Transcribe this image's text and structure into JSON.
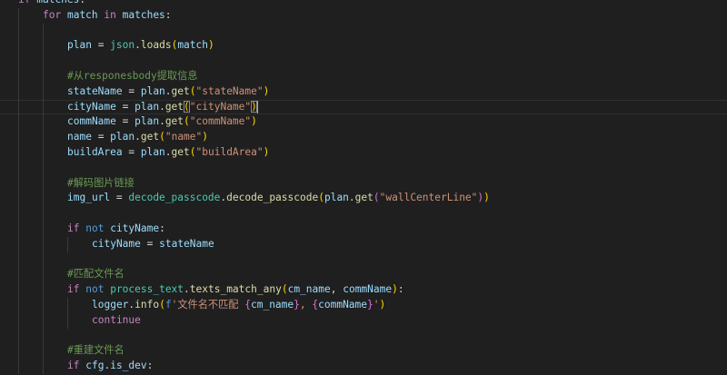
{
  "editor": {
    "current_line": 7,
    "lines": [
      {
        "indent": 0,
        "tokens": [
          [
            "if",
            "kw"
          ],
          [
            " ",
            "op"
          ],
          [
            "matches",
            "var"
          ],
          [
            ":",
            "op"
          ]
        ]
      },
      {
        "indent": 1,
        "tokens": [
          [
            "for",
            "kw"
          ],
          [
            " ",
            "op"
          ],
          [
            "match",
            "var"
          ],
          [
            " ",
            "op"
          ],
          [
            "in",
            "kw"
          ],
          [
            " ",
            "op"
          ],
          [
            "matches",
            "var"
          ],
          [
            ":",
            "op"
          ]
        ]
      },
      {
        "indent": 2,
        "tokens": []
      },
      {
        "indent": 2,
        "tokens": [
          [
            "plan",
            "var"
          ],
          [
            " = ",
            "op"
          ],
          [
            "json",
            "mod"
          ],
          [
            ".",
            "op"
          ],
          [
            "loads",
            "fn"
          ],
          [
            "(",
            "b1"
          ],
          [
            "match",
            "var"
          ],
          [
            ")",
            "b1"
          ]
        ]
      },
      {
        "indent": 2,
        "tokens": []
      },
      {
        "indent": 2,
        "tokens": [
          [
            "#从responesbody提取信息",
            "cm"
          ]
        ]
      },
      {
        "indent": 2,
        "tokens": [
          [
            "stateName",
            "var"
          ],
          [
            " = ",
            "op"
          ],
          [
            "plan",
            "var"
          ],
          [
            ".",
            "op"
          ],
          [
            "get",
            "fn"
          ],
          [
            "(",
            "b1"
          ],
          [
            "\"stateName\"",
            "str"
          ],
          [
            ")",
            "b1"
          ]
        ]
      },
      {
        "indent": 2,
        "tokens": [
          [
            "cityName",
            "var"
          ],
          [
            " = ",
            "op"
          ],
          [
            "plan",
            "var"
          ],
          [
            ".",
            "op"
          ],
          [
            "get",
            "fn"
          ],
          [
            "(",
            "b1 match"
          ],
          [
            "\"cityName\"",
            "str"
          ],
          [
            ")",
            "b1 match"
          ]
        ]
      },
      {
        "indent": 2,
        "tokens": [
          [
            "commName",
            "var"
          ],
          [
            " = ",
            "op"
          ],
          [
            "plan",
            "var"
          ],
          [
            ".",
            "op"
          ],
          [
            "get",
            "fn"
          ],
          [
            "(",
            "b1"
          ],
          [
            "\"commName\"",
            "str"
          ],
          [
            ")",
            "b1"
          ]
        ]
      },
      {
        "indent": 2,
        "tokens": [
          [
            "name",
            "var"
          ],
          [
            " = ",
            "op"
          ],
          [
            "plan",
            "var"
          ],
          [
            ".",
            "op"
          ],
          [
            "get",
            "fn"
          ],
          [
            "(",
            "b1"
          ],
          [
            "\"name\"",
            "str"
          ],
          [
            ")",
            "b1"
          ]
        ]
      },
      {
        "indent": 2,
        "tokens": [
          [
            "buildArea",
            "var"
          ],
          [
            " = ",
            "op"
          ],
          [
            "plan",
            "var"
          ],
          [
            ".",
            "op"
          ],
          [
            "get",
            "fn"
          ],
          [
            "(",
            "b1"
          ],
          [
            "\"buildArea\"",
            "str"
          ],
          [
            ")",
            "b1"
          ]
        ]
      },
      {
        "indent": 2,
        "tokens": []
      },
      {
        "indent": 2,
        "tokens": [
          [
            "#解码图片链接",
            "cm"
          ]
        ]
      },
      {
        "indent": 2,
        "tokens": [
          [
            "img_url",
            "var"
          ],
          [
            " = ",
            "op"
          ],
          [
            "decode_passcode",
            "mod"
          ],
          [
            ".",
            "op"
          ],
          [
            "decode_passcode",
            "fn"
          ],
          [
            "(",
            "b1"
          ],
          [
            "plan",
            "var"
          ],
          [
            ".",
            "op"
          ],
          [
            "get",
            "fn"
          ],
          [
            "(",
            "b2"
          ],
          [
            "\"wallCenterLine\"",
            "str"
          ],
          [
            ")",
            "b2"
          ],
          [
            ")",
            "b1"
          ]
        ]
      },
      {
        "indent": 2,
        "tokens": []
      },
      {
        "indent": 2,
        "tokens": [
          [
            "if",
            "kw"
          ],
          [
            " ",
            "op"
          ],
          [
            "not",
            "kb"
          ],
          [
            " ",
            "op"
          ],
          [
            "cityName",
            "var"
          ],
          [
            ":",
            "op"
          ]
        ]
      },
      {
        "indent": 3,
        "tokens": [
          [
            "cityName",
            "var"
          ],
          [
            " = ",
            "op"
          ],
          [
            "stateName",
            "var"
          ]
        ]
      },
      {
        "indent": 2,
        "tokens": []
      },
      {
        "indent": 2,
        "tokens": [
          [
            "#匹配文件名",
            "cm"
          ]
        ]
      },
      {
        "indent": 2,
        "tokens": [
          [
            "if",
            "kw"
          ],
          [
            " ",
            "op"
          ],
          [
            "not",
            "kb"
          ],
          [
            " ",
            "op"
          ],
          [
            "process_text",
            "mod"
          ],
          [
            ".",
            "op"
          ],
          [
            "texts_match_any",
            "fn"
          ],
          [
            "(",
            "b1"
          ],
          [
            "cm_name",
            "var"
          ],
          [
            ", ",
            "op"
          ],
          [
            "commName",
            "var"
          ],
          [
            ")",
            "b1"
          ],
          [
            ":",
            "op"
          ]
        ]
      },
      {
        "indent": 3,
        "tokens": [
          [
            "logger",
            "var"
          ],
          [
            ".",
            "op"
          ],
          [
            "info",
            "fn"
          ],
          [
            "(",
            "b1"
          ],
          [
            "f",
            "kb"
          ],
          [
            "'文件名不匹配 ",
            "str"
          ],
          [
            "{",
            "b2"
          ],
          [
            "cm_name",
            "var"
          ],
          [
            "}",
            "b2"
          ],
          [
            ", ",
            "str"
          ],
          [
            "{",
            "b2"
          ],
          [
            "commName",
            "var"
          ],
          [
            "}",
            "b2"
          ],
          [
            "'",
            "str"
          ],
          [
            ")",
            "b1"
          ]
        ]
      },
      {
        "indent": 3,
        "tokens": [
          [
            "continue",
            "kw"
          ]
        ]
      },
      {
        "indent": 2,
        "tokens": []
      },
      {
        "indent": 2,
        "tokens": [
          [
            "#重建文件名",
            "cm"
          ]
        ]
      },
      {
        "indent": 2,
        "tokens": [
          [
            "if",
            "kw"
          ],
          [
            " ",
            "op"
          ],
          [
            "cfg",
            "var"
          ],
          [
            ".",
            "op"
          ],
          [
            "is_dev",
            "var"
          ],
          [
            ":",
            "op"
          ]
        ]
      }
    ]
  }
}
